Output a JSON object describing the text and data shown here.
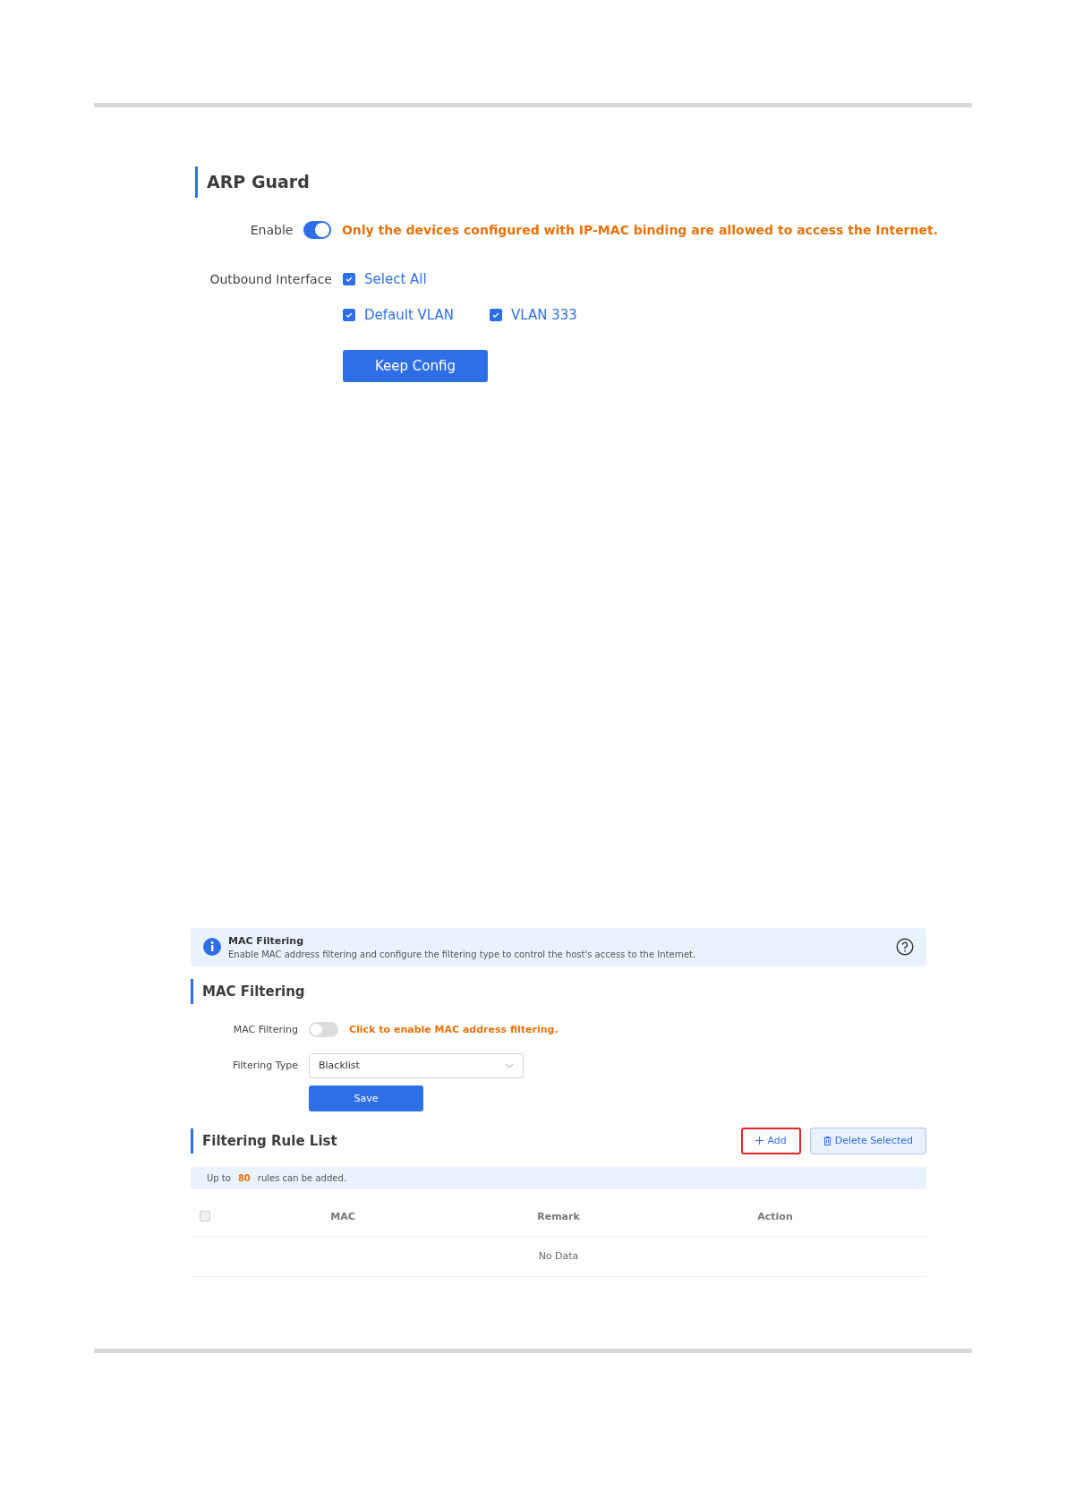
{
  "arp_guard": {
    "title": "ARP Guard",
    "enable": {
      "label": "Enable",
      "on": true,
      "hint": "Only the devices configured with IP-MAC binding are allowed to access the Internet."
    },
    "outbound": {
      "label": "Outbound Interface",
      "select_all": {
        "label": "Select All",
        "checked": true
      },
      "interfaces": [
        {
          "label": "Default VLAN",
          "checked": true
        },
        {
          "label": "VLAN 333",
          "checked": true
        }
      ]
    },
    "button": "Keep Config"
  },
  "mac_filtering": {
    "banner": {
      "title": "MAC Filtering",
      "text": "Enable MAC address filtering and configure the filtering type to control the host's access to the Internet."
    },
    "title": "MAC Filtering",
    "toggle": {
      "label": "MAC Filtering",
      "on": false,
      "hint": "Click to enable MAC address filtering."
    },
    "filtering_type": {
      "label": "Filtering Type",
      "value": "Blacklist"
    },
    "button": "Save"
  },
  "rule_list": {
    "title": "Filtering Rule List",
    "add": {
      "label": "Add",
      "highlighted": true
    },
    "delete": {
      "label": "Delete Selected"
    },
    "note": {
      "prefix": "Up to",
      "count": "80",
      "suffix": "rules can be added."
    },
    "table": {
      "select_all_checked": false,
      "columns": [
        "MAC",
        "Remark",
        "Action"
      ],
      "empty": "No Data"
    }
  }
}
